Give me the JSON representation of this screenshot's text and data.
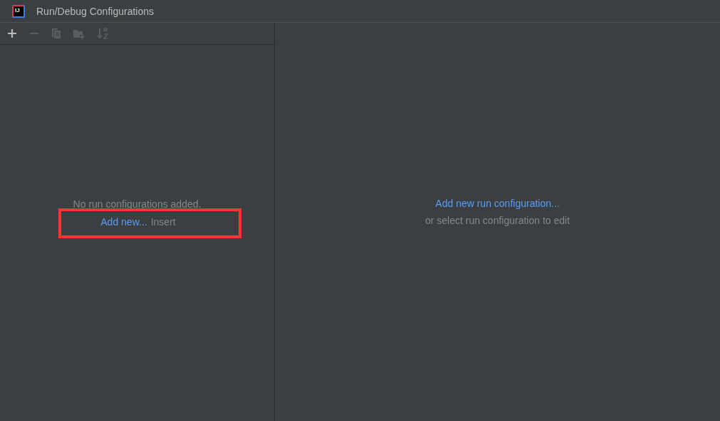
{
  "window": {
    "logo": "IJ",
    "title": "Run/Debug Configurations"
  },
  "toolbar": [
    {
      "kind": "add",
      "disabled": false
    },
    {
      "kind": "remove",
      "disabled": true
    },
    {
      "kind": "copy",
      "disabled": true
    },
    {
      "kind": "folder",
      "disabled": true
    },
    {
      "kind": "sort",
      "disabled": true
    }
  ],
  "left_panel": {
    "empty_text": "No run configurations added.",
    "link": "Add new...",
    "shortcut": "Insert",
    "highlighted": true
  },
  "right_panel": {
    "link": "Add new run configuration...",
    "hint": "or select run configuration to edit"
  }
}
